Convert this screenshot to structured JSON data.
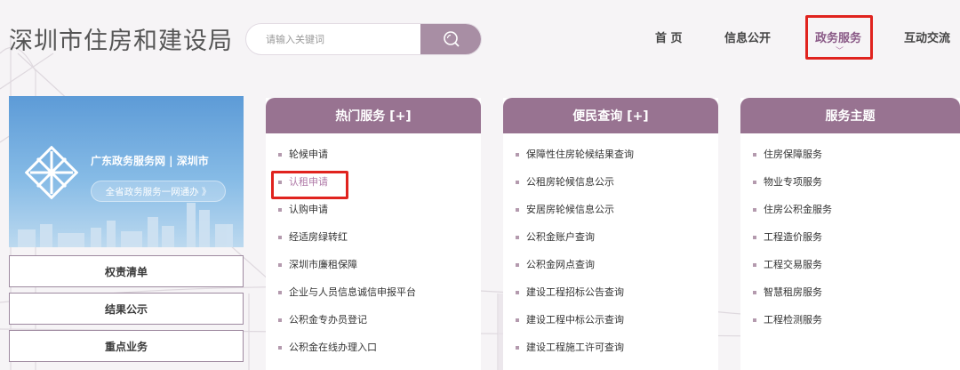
{
  "header": {
    "site_title": "深圳市住房和建设局",
    "search": {
      "placeholder": "请输入关键词"
    },
    "nav": [
      {
        "label": "首 页"
      },
      {
        "label": "信息公开"
      },
      {
        "label": "政务服务",
        "active": true
      },
      {
        "label": "互动交流"
      }
    ]
  },
  "sidebar": {
    "banner": {
      "title": "广东政务服务网 | 深圳市",
      "pill": "全省政务服务一网通办 》"
    },
    "buttons": [
      {
        "label": "权责清单"
      },
      {
        "label": "结果公示"
      },
      {
        "label": "重点业务"
      }
    ]
  },
  "columns": [
    {
      "title": "热门服务 [+]",
      "items": [
        "轮候申请",
        "认租申请",
        "认购申请",
        "经适房绿转红",
        "深圳市廉租保障",
        "企业与人员信息诚信申报平台",
        "公积金专办员登记",
        "公积金在线办理入口"
      ]
    },
    {
      "title": "便民查询 [+]",
      "items": [
        "保障性住房轮候结果查询",
        "公租房轮候信息公示",
        "安居房轮候信息公示",
        "公积金账户查询",
        "公积金网点查询",
        "建设工程招标公告查询",
        "建设工程中标公示查询",
        "建设工程施工许可查询"
      ]
    },
    {
      "title": "服务主题",
      "items": [
        "住房保障服务",
        "物业专项服务",
        "住房公积金服务",
        "工程造价服务",
        "工程交易服务",
        "智慧租房服务",
        "工程检测服务"
      ]
    }
  ],
  "colors": {
    "accent": "#987391",
    "highlight_box": "#e0231e",
    "banner_blue": "#5d9bd7"
  },
  "icons": [
    "search-icon",
    "guangdong-gov-logo-icon",
    "chevron-down-icon"
  ]
}
